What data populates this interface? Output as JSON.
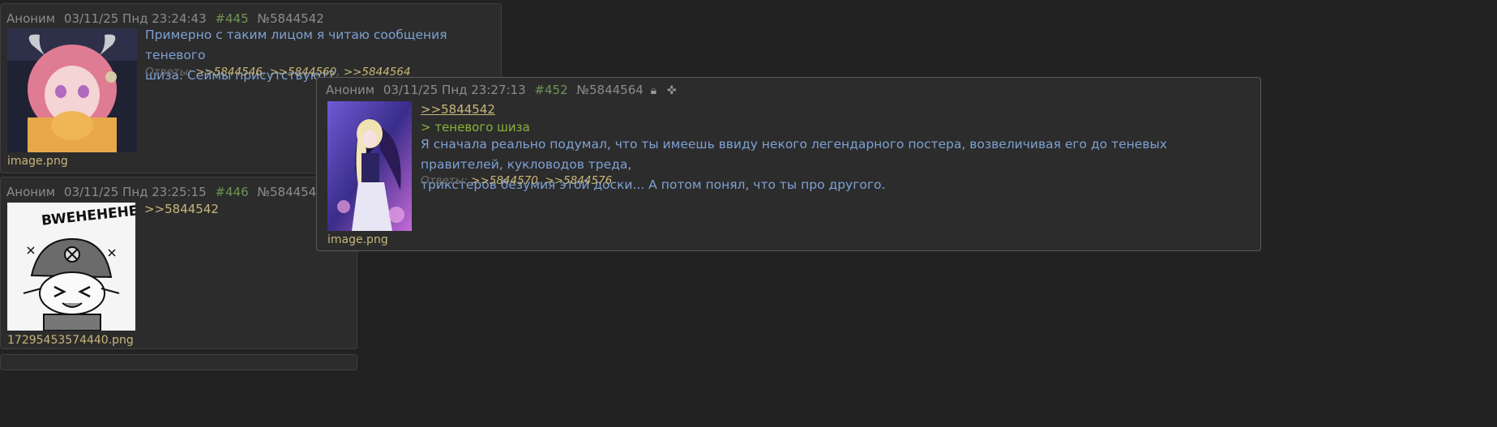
{
  "posts": [
    {
      "author": "Аноним",
      "date": "03/11/25 Пнд 23:24:43",
      "num": "#445",
      "id": "№5844542",
      "text1": "Примерно с таким лицом я читаю сообщения теневого",
      "text2": "шиза. Сеймы присутствуют?",
      "replies_label": "Ответы:",
      "replies": [
        ">>5844546",
        ">>5844560",
        ">>5844564"
      ],
      "filename": "image.png"
    },
    {
      "author": "Аноним",
      "date": "03/11/25 Пнд 23:25:15",
      "num": "#446",
      "id": "№5844546",
      "reply_to": ">>5844542",
      "filename": "17295453574440.png",
      "image_text": "BWEHEHEHE"
    }
  ],
  "popup": {
    "author": "Аноним",
    "date": "03/11/25 Пнд 23:27:13",
    "num": "#452",
    "id": "№5844564",
    "reply_to": ">>5844542",
    "quote": "> теневого шиза",
    "text1": "Я сначала реально подумал, что ты имеешь ввиду некого легендарного постера, возвеличивая его до теневых правителей, кукловодов треда,",
    "text2": "трикстеров безумия этой доски... А потом понял, что ты про другого.",
    "replies_label": "Ответы:",
    "replies": [
      ">>5844570",
      ">>5844576"
    ],
    "filename": "image.png",
    "icons": [
      "lock-icon",
      "move-icon"
    ]
  },
  "colors": {
    "background": "#222222",
    "post_bg": "#2c2c2c",
    "text": "#7ea1d3",
    "link": "#c9b67a",
    "quote": "#86b43a",
    "number": "#6f9453"
  }
}
